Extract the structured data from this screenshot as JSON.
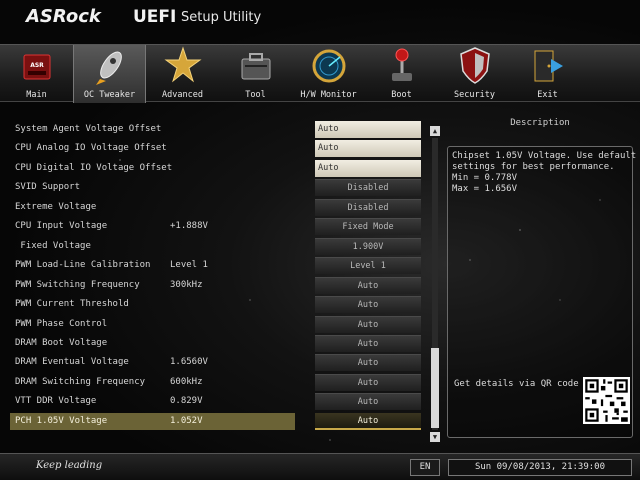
{
  "header": {
    "brand": "ASRock",
    "title": "UEFI",
    "subtitle": "Setup Utility"
  },
  "nav": {
    "active_index": 1,
    "tabs": [
      {
        "label": "Main",
        "icon": "asrock-board-icon"
      },
      {
        "label": "OC Tweaker",
        "icon": "rocket-icon"
      },
      {
        "label": "Advanced",
        "icon": "star-burst-icon"
      },
      {
        "label": "Tool",
        "icon": "toolbox-icon"
      },
      {
        "label": "H/W Monitor",
        "icon": "radar-icon"
      },
      {
        "label": "Boot",
        "icon": "joystick-icon"
      },
      {
        "label": "Security",
        "icon": "shield-icon"
      },
      {
        "label": "Exit",
        "icon": "exit-door-icon"
      }
    ]
  },
  "settings": [
    {
      "name": "System Agent Voltage Offset",
      "current": "",
      "value": "Auto",
      "style": "auto-w"
    },
    {
      "name": "CPU Analog IO Voltage Offset",
      "current": "",
      "value": "Auto",
      "style": "auto-w"
    },
    {
      "name": "CPU Digital IO Voltage Offset",
      "current": "",
      "value": "Auto",
      "style": "auto-w"
    },
    {
      "name": "SVID Support",
      "current": "",
      "value": "Disabled",
      "style": "dark"
    },
    {
      "name": "Extreme Voltage",
      "current": "",
      "value": "Disabled",
      "style": "dark"
    },
    {
      "name": "CPU Input Voltage",
      "current": "+1.888V",
      "value": "Fixed Mode",
      "style": "dark"
    },
    {
      "name": " Fixed Voltage",
      "current": "",
      "value": "1.900V",
      "style": "dark"
    },
    {
      "name": "PWM Load-Line Calibration",
      "current": "Level 1",
      "value": "Level 1",
      "style": "dark"
    },
    {
      "name": "PWM Switching Frequency",
      "current": "300kHz",
      "value": "Auto",
      "style": "dark"
    },
    {
      "name": "PWM Current Threshold",
      "current": "",
      "value": "Auto",
      "style": "dark"
    },
    {
      "name": "PWM Phase Control",
      "current": "",
      "value": "Auto",
      "style": "dark"
    },
    {
      "name": "DRAM Boot Voltage",
      "current": "",
      "value": "Auto",
      "style": "dark"
    },
    {
      "name": "DRAM Eventual Voltage",
      "current": "1.6560V",
      "value": "Auto",
      "style": "dark"
    },
    {
      "name": "DRAM Switching Frequency",
      "current": "600kHz",
      "value": "Auto",
      "style": "dark"
    },
    {
      "name": "VTT DDR Voltage",
      "current": "0.829V",
      "value": "Auto",
      "style": "dark"
    },
    {
      "name": "PCH 1.05V Voltage",
      "current": "1.052V",
      "value": "Auto",
      "style": "gold",
      "selected": true
    }
  ],
  "description": {
    "title": "Description",
    "lines": [
      "Chipset 1.05V Voltage. Use default",
      "settings for best performance.",
      "Min = 0.778V",
      "Max = 1.656V"
    ],
    "qr_text": "Get details via QR code"
  },
  "footer": {
    "signature": "Keep leading",
    "language": "EN",
    "datetime": "Sun 09/08/2013, 21:39:00"
  }
}
